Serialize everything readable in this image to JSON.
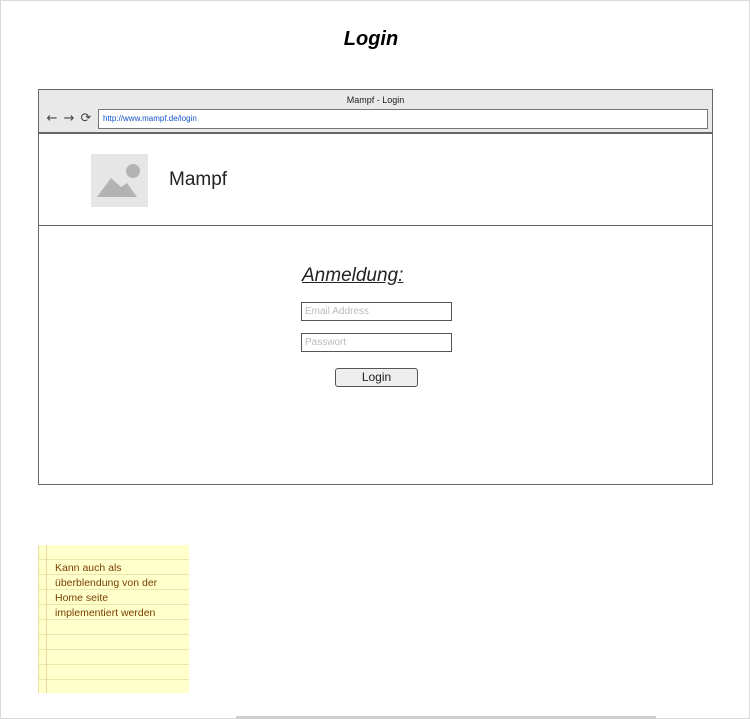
{
  "page": {
    "title": "Login"
  },
  "browser": {
    "window_title": "Mampf - Login",
    "url": "http://www.mampf.de/login",
    "icons": {
      "back": "back-arrow-icon",
      "forward": "forward-arrow-icon",
      "reload": "reload-icon"
    }
  },
  "header": {
    "logo_icon": "image-placeholder-icon",
    "brand": "Mampf"
  },
  "login_form": {
    "heading": "Anmeldung:",
    "email_placeholder": "Email Address",
    "password_placeholder": "Passwort",
    "login_label": "Login"
  },
  "note": {
    "lines": [
      "Kann auch als",
      "überblendung von der",
      "Home seite",
      "implementiert werden"
    ]
  }
}
